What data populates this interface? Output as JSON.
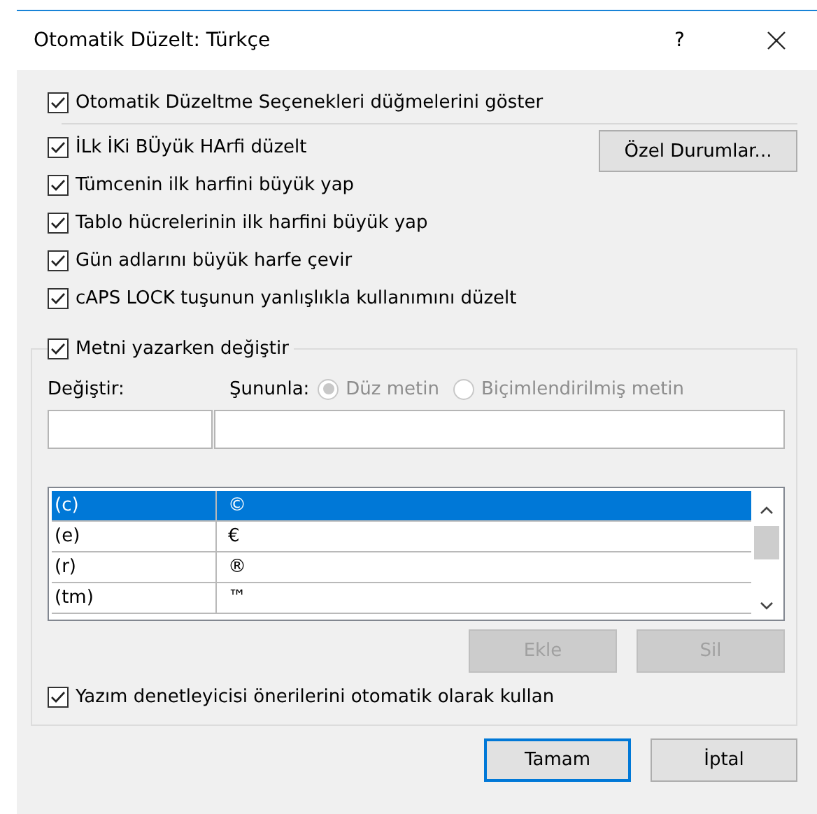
{
  "window": {
    "title": "Otomatik Düzelt: Türkçe",
    "help": "?"
  },
  "top_option": {
    "label": "Otomatik Düzeltme Seçenekleri düğmelerini göster",
    "checked": true
  },
  "options": [
    {
      "label": "İLk İKi BÜyük HArfi düzelt",
      "checked": true
    },
    {
      "label": "Tümcenin ilk harfini büyük yap",
      "checked": true
    },
    {
      "label": "Tablo hücrelerinin ilk harfini büyük yap",
      "checked": true
    },
    {
      "label": "Gün adlarını büyük harfe çevir",
      "checked": true
    },
    {
      "label": "cAPS LOCK tuşunun yanlışlıkla kullanımını düzelt",
      "checked": true
    }
  ],
  "exceptions_button": {
    "label": "Özel Durumlar..."
  },
  "replace_group": {
    "label": "Metni yazarken değiştir",
    "checked": true
  },
  "replace_label": "Değiştir:",
  "with_label": "Şununla:",
  "format_options": [
    {
      "label": "Düz metin",
      "selected": true,
      "disabled": true
    },
    {
      "label": "Biçimlendirilmiş metin",
      "selected": false,
      "disabled": true
    }
  ],
  "entries": [
    {
      "replace": "(c)",
      "with": "©",
      "selected": true
    },
    {
      "replace": "(e)",
      "with": "€",
      "selected": false
    },
    {
      "replace": "(r)",
      "with": "®",
      "selected": false
    },
    {
      "replace": "(tm)",
      "with": "™",
      "selected": false
    }
  ],
  "list_buttons": [
    {
      "label": "Ekle",
      "disabled": true
    },
    {
      "label": "Sil",
      "disabled": true
    }
  ],
  "spell_option": {
    "label": "Yazım denetleyicisi önerilerini otomatik olarak kullan",
    "checked": true
  },
  "buttons": [
    {
      "label": "Tamam",
      "default": true
    },
    {
      "label": "İptal",
      "default": false
    }
  ]
}
